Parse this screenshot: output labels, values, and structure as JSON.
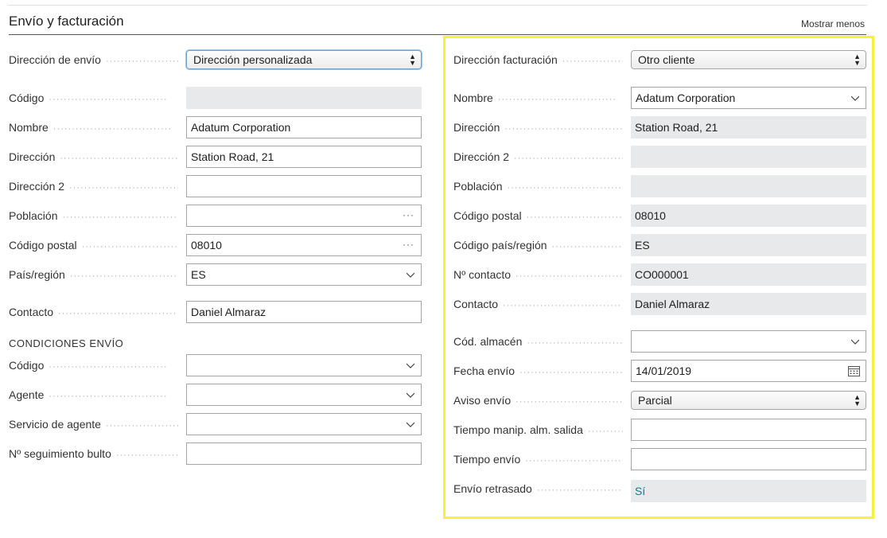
{
  "header": {
    "title": "Envío y facturación",
    "toggle_label": "Mostrar menos"
  },
  "shipping": {
    "ship_to_label": "Dirección de envío",
    "ship_to_value": "Dirección personalizada",
    "code_label": "Código",
    "code_value": "",
    "name_label": "Nombre",
    "name_value": "Adatum Corporation",
    "address_label": "Dirección",
    "address_value": "Station Road, 21",
    "address2_label": "Dirección 2",
    "address2_value": "",
    "city_label": "Población",
    "city_value": "",
    "postcode_label": "Código postal",
    "postcode_value": "08010",
    "country_label": "País/región",
    "country_value": "ES",
    "contact_label": "Contacto",
    "contact_value": "Daniel Almaraz"
  },
  "conditions": {
    "heading": "CONDICIONES ENVÍO",
    "code_label": "Código",
    "code_value": "",
    "agent_label": "Agente",
    "agent_value": "",
    "agent_service_label": "Servicio de agente",
    "agent_service_value": "",
    "tracking_label": "Nº seguimiento bulto",
    "tracking_value": ""
  },
  "billing": {
    "bill_to_label": "Dirección facturación",
    "bill_to_value": "Otro cliente",
    "name_label": "Nombre",
    "name_value": "Adatum Corporation",
    "address_label": "Dirección",
    "address_value": "Station Road, 21",
    "address2_label": "Dirección 2",
    "address2_value": "",
    "city_label": "Población",
    "city_value": "",
    "postcode_label": "Código postal",
    "postcode_value": "08010",
    "country_label": "Código país/región",
    "country_value": "ES",
    "contact_no_label": "Nº contacto",
    "contact_no_value": "CO000001",
    "contact_label": "Contacto",
    "contact_value": "Daniel Almaraz",
    "location_label": "Cód. almacén",
    "location_value": "",
    "shipment_date_label": "Fecha envío",
    "shipment_date_value": "14/01/2019",
    "shipping_advice_label": "Aviso envío",
    "shipping_advice_value": "Parcial",
    "outbound_time_label": "Tiempo manip. alm. salida",
    "outbound_time_value": "",
    "shipping_time_label": "Tiempo envío",
    "shipping_time_value": "",
    "late_label": "Envío retrasado",
    "late_value": "Sí"
  },
  "colors": {
    "highlight": "#f6f23a",
    "readonly_bg": "#e8e9ea",
    "link": "#008489"
  }
}
